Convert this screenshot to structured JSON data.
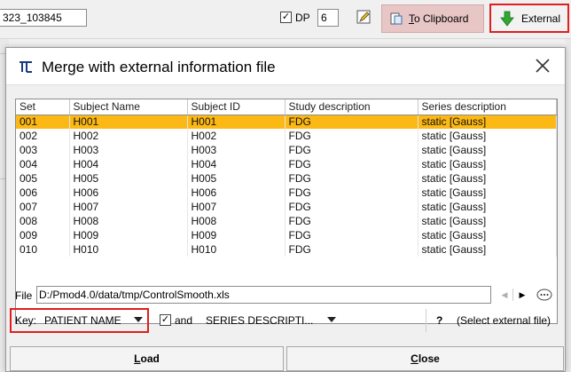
{
  "background": {
    "field_value": "323_103845",
    "dp_label": "DP",
    "dp_checked": true,
    "dp_value": "6",
    "clipboard_label_u": "T",
    "clipboard_label_rest": "o Clipboard",
    "external_label": "External"
  },
  "dialog": {
    "title": "Merge with external information file",
    "table": {
      "columns": [
        "Set",
        "Subject Name",
        "Subject ID",
        "Study description",
        "Series description"
      ],
      "rows": [
        [
          "001",
          "H001",
          "H001",
          "FDG",
          "static [Gauss]"
        ],
        [
          "002",
          "H002",
          "H002",
          "FDG",
          "static [Gauss]"
        ],
        [
          "003",
          "H003",
          "H003",
          "FDG",
          "static [Gauss]"
        ],
        [
          "004",
          "H004",
          "H004",
          "FDG",
          "static [Gauss]"
        ],
        [
          "005",
          "H005",
          "H005",
          "FDG",
          "static [Gauss]"
        ],
        [
          "006",
          "H006",
          "H006",
          "FDG",
          "static [Gauss]"
        ],
        [
          "007",
          "H007",
          "H007",
          "FDG",
          "static [Gauss]"
        ],
        [
          "008",
          "H008",
          "H008",
          "FDG",
          "static [Gauss]"
        ],
        [
          "009",
          "H009",
          "H009",
          "FDG",
          "static [Gauss]"
        ],
        [
          "010",
          "H010",
          "H010",
          "FDG",
          "static [Gauss]"
        ]
      ],
      "selected_row": 0
    },
    "file_label": "File",
    "file_path": "D:/Pmod4.0/data/tmp/ControlSmooth.xls",
    "key_label": "Key:",
    "key_value": "PATIENT NAME",
    "and_checked": true,
    "and_label": "and",
    "series_value": "SERIES DESCRIPTI...",
    "help_label": "?",
    "select_external_label": "(Select external file)",
    "load_u": "L",
    "load_rest": "oad",
    "close_u": "C",
    "close_rest": "lose"
  },
  "colors": {
    "selected_row": "#fcb815",
    "highlight_border": "#e01e1e",
    "clipboard_bg": "#e8c6c6",
    "external_arrow": "#2fa82f"
  }
}
